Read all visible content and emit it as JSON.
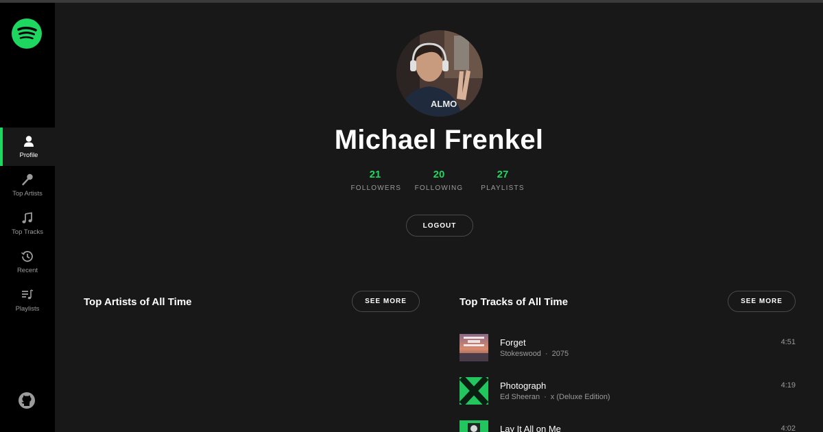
{
  "theme": {
    "accent": "#1ed760",
    "background": "#181818",
    "sidebar": "#000000",
    "muted": "#9b9b9b"
  },
  "sidebar": {
    "logo_icon": "spotify-logo-icon",
    "items": [
      {
        "label": "Profile",
        "icon": "user-icon",
        "active": true
      },
      {
        "label": "Top Artists",
        "icon": "microphone-icon",
        "active": false
      },
      {
        "label": "Top Tracks",
        "icon": "music-note-icon",
        "active": false
      },
      {
        "label": "Recent",
        "icon": "history-icon",
        "active": false
      },
      {
        "label": "Playlists",
        "icon": "playlist-icon",
        "active": false
      }
    ],
    "footer_icon": "github-icon"
  },
  "profile": {
    "name": "Michael Frenkel",
    "stats": [
      {
        "value": "21",
        "label": "FOLLOWERS"
      },
      {
        "value": "20",
        "label": "FOLLOWING"
      },
      {
        "value": "27",
        "label": "PLAYLISTS"
      }
    ],
    "logout_label": "LOGOUT"
  },
  "top_artists": {
    "title": "Top Artists of All Time",
    "see_more_label": "SEE MORE"
  },
  "top_tracks": {
    "title": "Top Tracks of All Time",
    "see_more_label": "SEE MORE",
    "tracks": [
      {
        "name": "Forget",
        "artist": "Stokeswood",
        "album": "2075",
        "duration": "4:51"
      },
      {
        "name": "Photograph",
        "artist": "Ed Sheeran",
        "album": "x (Deluxe Edition)",
        "duration": "4:19"
      },
      {
        "name": "Lay It All on Me",
        "artist": "",
        "album": "",
        "duration": "4:02"
      }
    ]
  }
}
